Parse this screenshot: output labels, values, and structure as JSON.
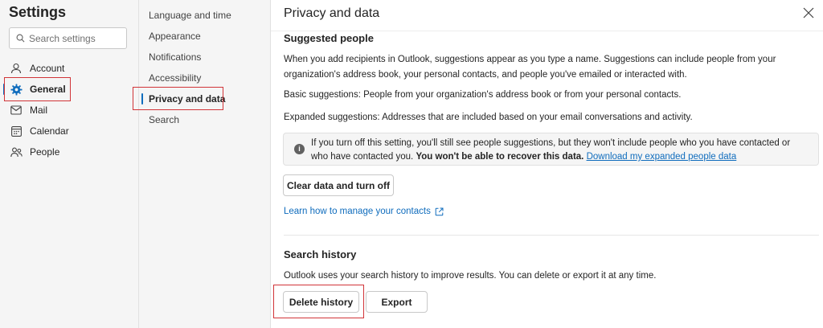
{
  "sidebar": {
    "title": "Settings",
    "search_placeholder": "Search settings",
    "items": [
      {
        "label": "Account",
        "icon": "person-icon"
      },
      {
        "label": "General",
        "icon": "gear-icon",
        "selected": true
      },
      {
        "label": "Mail",
        "icon": "mail-icon"
      },
      {
        "label": "Calendar",
        "icon": "calendar-icon"
      },
      {
        "label": "People",
        "icon": "people-icon"
      }
    ]
  },
  "subnav": {
    "items": [
      {
        "label": "Language and time"
      },
      {
        "label": "Appearance"
      },
      {
        "label": "Notifications"
      },
      {
        "label": "Accessibility"
      },
      {
        "label": "Privacy and data",
        "selected": true
      },
      {
        "label": "Search"
      }
    ]
  },
  "main": {
    "title": "Privacy and data",
    "suggested": {
      "heading": "Suggested people",
      "para1": "When you add recipients in Outlook, suggestions appear as you type a name. Suggestions can include people from your organization's address book, your personal contacts, and people you've emailed or interacted with.",
      "para2": "Basic suggestions: People from your organization's address book or from your personal contacts.",
      "para3": "Expanded suggestions: Addresses that are included based on your email conversations and activity.",
      "info_text": "If you turn off this setting, you'll still see people suggestions, but they won't include people who you have contacted or who have contacted you.",
      "info_bold": "You won't be able to recover this data.",
      "info_link": "Download my expanded people data",
      "clear_button": "Clear data and turn off",
      "learn_link": "Learn how to manage your contacts"
    },
    "search_history": {
      "heading": "Search history",
      "para": "Outlook uses your search history to improve results. You can delete or export it at any time.",
      "delete_button": "Delete history",
      "export_button": "Export"
    }
  },
  "colors": {
    "accent": "#0f6cbd",
    "highlight": "#d13438",
    "pane_bg": "#f5f5f5"
  }
}
